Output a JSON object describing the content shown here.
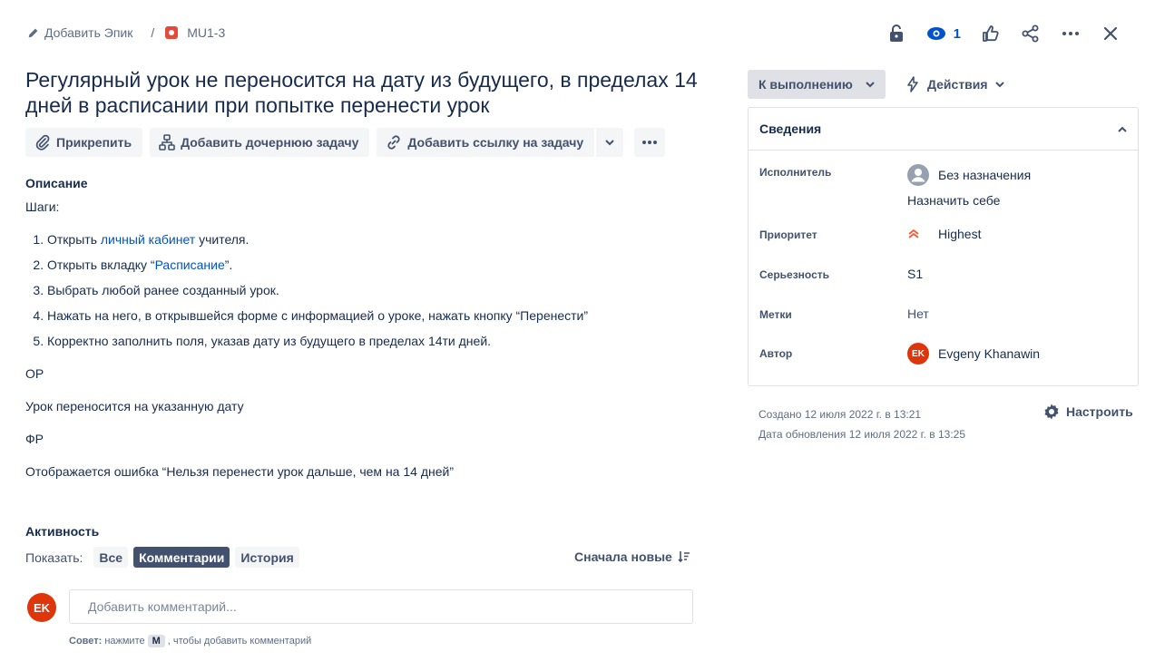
{
  "breadcrumb": {
    "add_epic": "Добавить Эпик",
    "separator": "/",
    "issue_key": "MU1-3"
  },
  "header": {
    "watchers_count": "1"
  },
  "issue": {
    "title": "Регулярный урок не переносится на дату из будущего, в пределах 14 дней в расписании при попытке перенести урок"
  },
  "toolbar": {
    "attach": "Прикрепить",
    "add_child": "Добавить дочернюю задачу",
    "add_link": "Добавить ссылку на задачу"
  },
  "description": {
    "heading": "Описание",
    "steps_label": "Шаги:",
    "step1_pre": "Открыть ",
    "step1_link": "личный кабинет",
    "step1_post": " учителя.",
    "step2_pre": "Открыть вкладку “",
    "step2_link": "Расписание",
    "step2_post": "”.",
    "step3": "Выбрать любой ранее созданный урок.",
    "step4": "Нажать на него, в открывшейся форме с информацией о уроке, нажать кнопку “Перенести”",
    "step5": "Корректно заполнить поля, указав дату из будущего в пределах 14ти дней.",
    "expected_label": "ОР",
    "expected": "Урок переносится на указанную дату",
    "actual_label": "ФР",
    "actual": "Отображается ошибка “Нельзя перенести урок дальше, чем на 14 дней”"
  },
  "activity": {
    "heading": "Активность",
    "show_label": "Показать:",
    "filters": [
      "Все",
      "Комментарии",
      "История"
    ],
    "sort": "Сначала новые",
    "comment_placeholder": "Добавить комментарий...",
    "avatar_initials": "EK",
    "tip_label": "Совет:",
    "tip_pre": "нажмите",
    "tip_key": "M",
    "tip_post": ", чтобы добавить комментарий"
  },
  "sidebar": {
    "status": "К выполнению",
    "actions": "Действия",
    "details_heading": "Сведения",
    "assignee_label": "Исполнитель",
    "assignee_value": "Без назначения",
    "assign_to_me": "Назначить себе",
    "priority_label": "Приоритет",
    "priority_value": "Highest",
    "severity_label": "Серьезность",
    "severity_value": "S1",
    "labels_label": "Метки",
    "labels_value": "Нет",
    "reporter_label": "Автор",
    "reporter_value": "Evgeny Khanawin",
    "reporter_initials": "EK",
    "created": "Создано 12 июля 2022 г. в 13:21",
    "updated": "Дата обновления 12 июля 2022 г. в 13:25",
    "configure": "Настроить"
  },
  "colors": {
    "link": "#0052cc",
    "avatar": "#de350b",
    "priority": "#ff5630",
    "bug": "#e5493a"
  }
}
